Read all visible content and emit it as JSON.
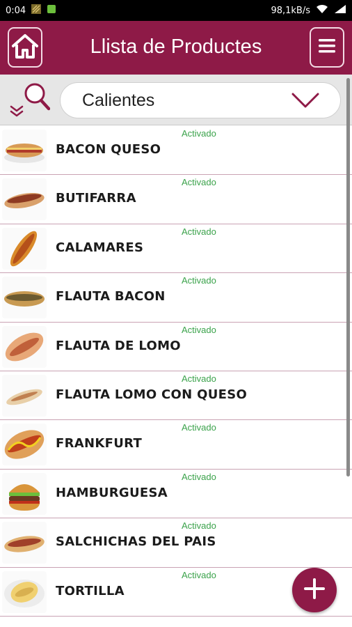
{
  "statusbar": {
    "time": "0:04",
    "speed": "98,1kB/s"
  },
  "appbar": {
    "title": "Llista de Productes",
    "home_icon": "home-icon",
    "menu_icon": "menu-icon"
  },
  "filter": {
    "selected": "Calientes",
    "search_icon": "search-filter-icon",
    "dropdown_icon": "chevron-down-icon"
  },
  "products": [
    {
      "name": "BACON QUESO",
      "status": "Activado"
    },
    {
      "name": "BUTIFARRA",
      "status": "Activado"
    },
    {
      "name": "CALAMARES",
      "status": "Activado"
    },
    {
      "name": "FLAUTA BACON",
      "status": "Activado"
    },
    {
      "name": "FLAUTA DE LOMO",
      "status": "Activado"
    },
    {
      "name": "FLAUTA LOMO CON QUESO",
      "status": "Activado"
    },
    {
      "name": "FRANKFURT",
      "status": "Activado"
    },
    {
      "name": "HAMBURGUESA",
      "status": "Activado"
    },
    {
      "name": "SALCHICHAS DEL PAIS",
      "status": "Activado"
    },
    {
      "name": "TORTILLA",
      "status": "Activado"
    }
  ],
  "fab": {
    "icon": "add-icon"
  },
  "colors": {
    "primary": "#8e1a47",
    "status_active": "#3aa24a"
  }
}
